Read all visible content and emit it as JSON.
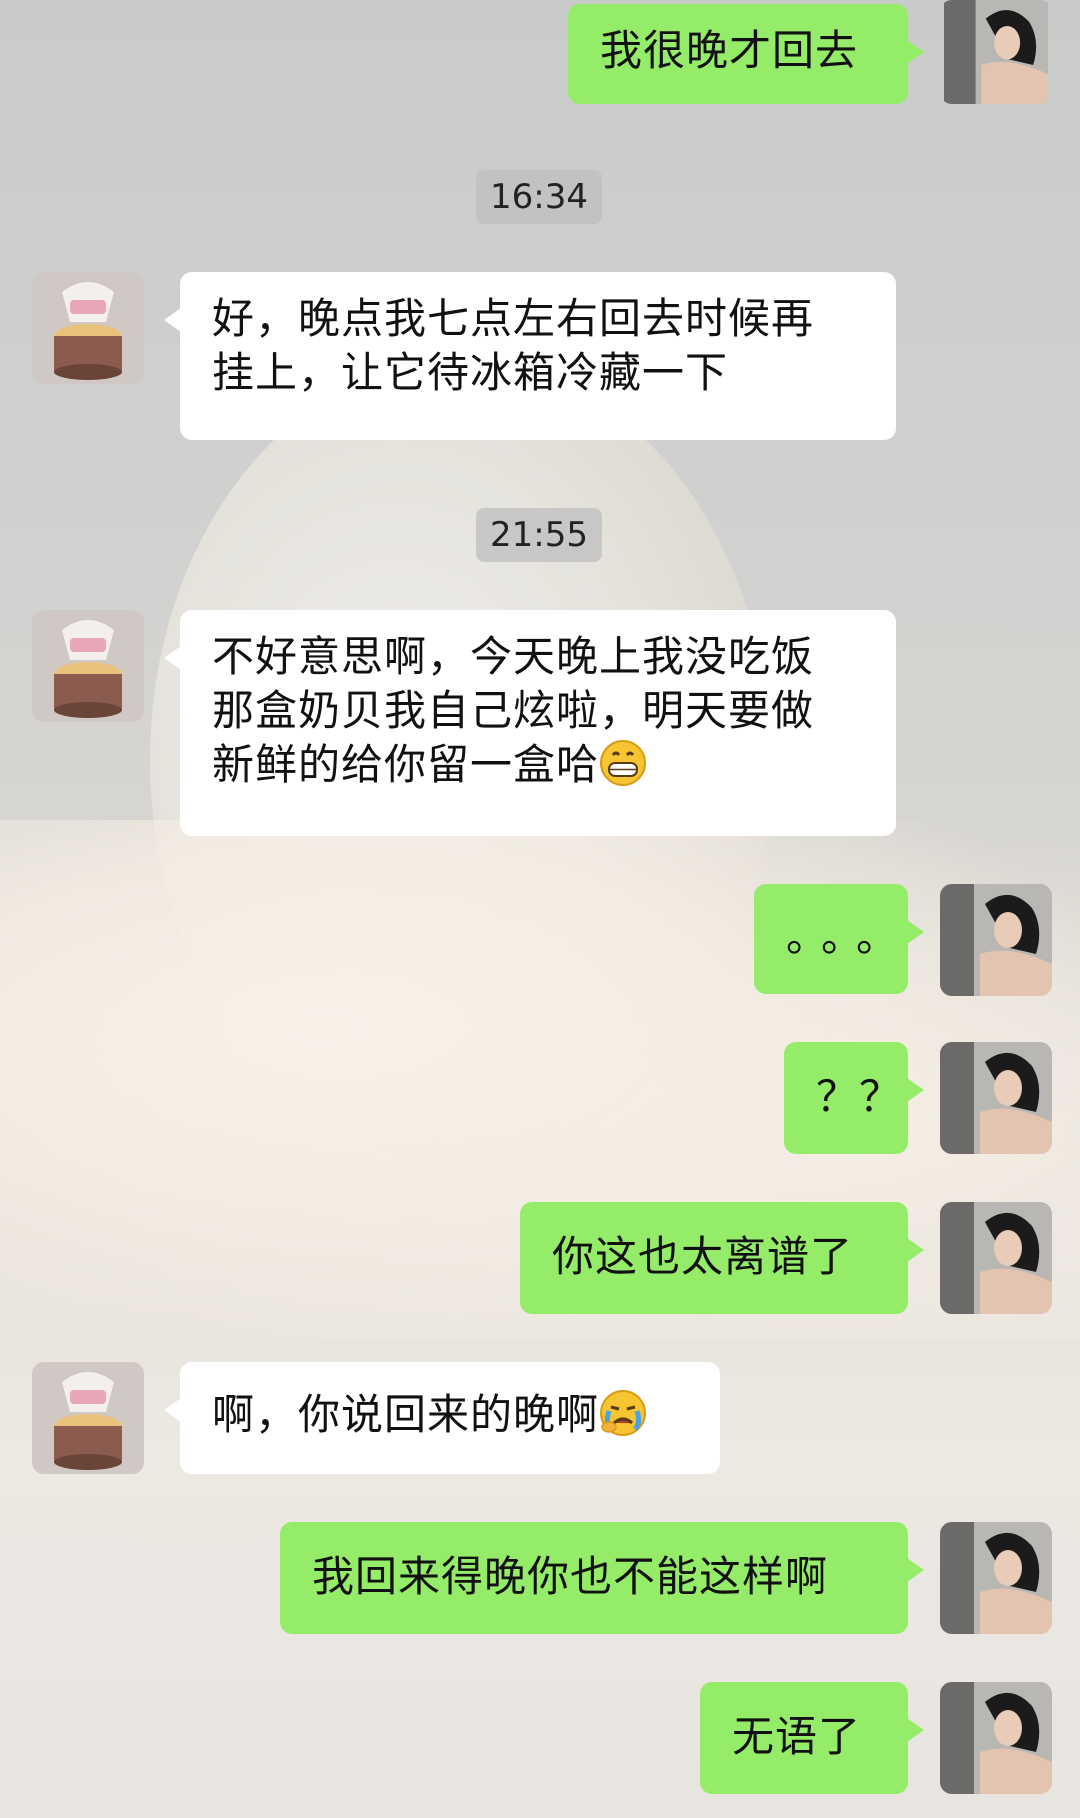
{
  "messages": [
    {
      "side": "me",
      "text": "我很晚才回去"
    },
    {
      "side": "time",
      "text": "16:34"
    },
    {
      "side": "other",
      "lines": [
        "好，晚点我七点左右回去时候再",
        "挂上，让它待冰箱冷藏一下"
      ]
    },
    {
      "side": "time",
      "text": "21:55"
    },
    {
      "side": "other",
      "lines": [
        "不好意思啊，今天晚上我没吃饭",
        "那盒奶贝我自己炫啦，明天要做",
        "新鲜的给你留一盒哈"
      ],
      "emoji": "grinning-face-icon"
    },
    {
      "side": "me",
      "text": "。。。"
    },
    {
      "side": "me",
      "text": "？？"
    },
    {
      "side": "me",
      "text": "你这也太离谱了"
    },
    {
      "side": "other",
      "text": "啊，你说回来的晚啊",
      "emoji": "crying-face-icon"
    },
    {
      "side": "me",
      "text": "我回来得晚你也不能这样啊"
    },
    {
      "side": "me",
      "text": "无语了"
    }
  ],
  "colors": {
    "my_bubble": "#95ec69",
    "other_bubble": "#ffffff",
    "time_bg": "#bebebe"
  },
  "avatars": {
    "me": "woman-portrait-avatar",
    "other": "cake-avatar"
  }
}
